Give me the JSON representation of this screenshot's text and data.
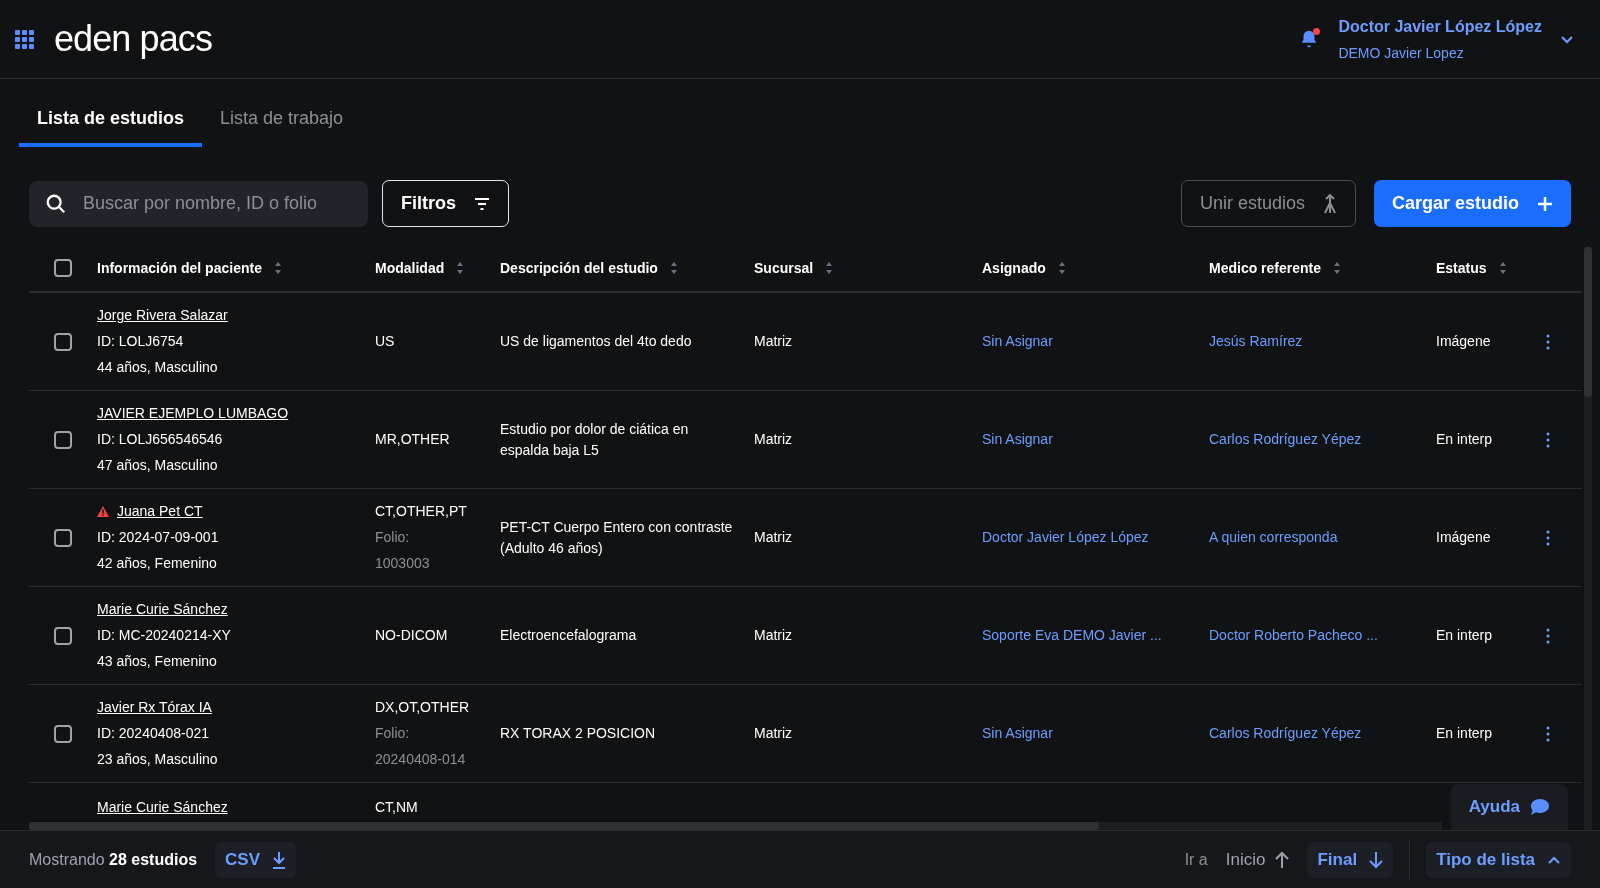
{
  "header": {
    "logo": "eden pacs",
    "user": {
      "name": "Doctor Javier López López",
      "account": "DEMO Javier Lopez"
    },
    "notification_unread": true
  },
  "tabs": [
    {
      "label": "Lista de estudios",
      "selected": true
    },
    {
      "label": "Lista de trabajo",
      "selected": false
    }
  ],
  "search": {
    "placeholder": "Buscar por nombre, ID o folio"
  },
  "toolbar": {
    "filters": "Filtros",
    "merge": {
      "label": "Unir estudios",
      "disabled": true
    },
    "upload": "Cargar estudio"
  },
  "table": {
    "select_all": false,
    "columns": [
      "Información del paciente",
      "Modalidad",
      "Descripción del estudio",
      "Sucursal",
      "Asignado",
      "Medico referente",
      "Estatus"
    ],
    "rows": [
      {
        "checked": false,
        "name": "Jorge Rivera Salazar",
        "warning": false,
        "id": "ID: LOLJ6754",
        "age_sex": "44 años, Masculino",
        "modality": "US",
        "description": "US de ligamentos del 4to dedo",
        "branch": "Matriz",
        "assigned": "Sin Asignar",
        "referrer": "Jesús Ramírez",
        "status": "Imágene"
      },
      {
        "checked": false,
        "name": "JAVIER EJEMPLO LUMBAGO",
        "warning": false,
        "id": "ID: LOLJ656546546",
        "age_sex": "47 años, Masculino",
        "modality": "MR,OTHER",
        "description": "Estudio por dolor de ciática en espalda baja L5",
        "branch": "Matriz",
        "assigned": "Sin Asignar",
        "referrer": "Carlos Rodríguez Yépez",
        "status": "En interp"
      },
      {
        "checked": false,
        "name": "Juana Pet CT",
        "warning": true,
        "id": "ID: 2024-07-09-001",
        "age_sex": "42 años, Femenino",
        "modality": "CT,OTHER,PT",
        "folio_label": "Folio:",
        "folio": "1003003",
        "description": "PET-CT Cuerpo Entero con contraste (Adulto 46 años)",
        "branch": "Matriz",
        "assigned": "Doctor Javier López López",
        "referrer": "A quien corresponda",
        "status": "Imágene"
      },
      {
        "checked": false,
        "name": "Marie Curie Sánchez",
        "warning": false,
        "id": "ID: MC-20240214-XY",
        "age_sex": "43 años, Femenino",
        "modality": "NO-DICOM",
        "description": "Electroencefalograma",
        "branch": "Matriz",
        "assigned": "Soporte Eva DEMO Javier ...",
        "referrer": "Doctor Roberto Pacheco ...",
        "status": "En interp"
      },
      {
        "checked": false,
        "name": "Javier Rx Tórax IA",
        "warning": false,
        "id": "ID: 20240408-021",
        "age_sex": "23 años, Masculino",
        "modality": "DX,OT,OTHER",
        "folio_label": "Folio:",
        "folio": "20240408-014",
        "description": "RX TORAX 2 POSICION",
        "branch": "Matriz",
        "assigned": "Sin Asignar",
        "referrer": "Carlos Rodríguez Yépez",
        "status": "En interp"
      }
    ],
    "partial_row": {
      "name": "Marie Curie Sánchez",
      "modality": "CT,NM"
    }
  },
  "help": "Ayuda",
  "footer": {
    "showing": "Mostrando **28 estudios**",
    "csv": "CSV",
    "goto": "Ir a",
    "start": "Inicio",
    "end": "Final",
    "list_type": "Tipo de lista"
  }
}
